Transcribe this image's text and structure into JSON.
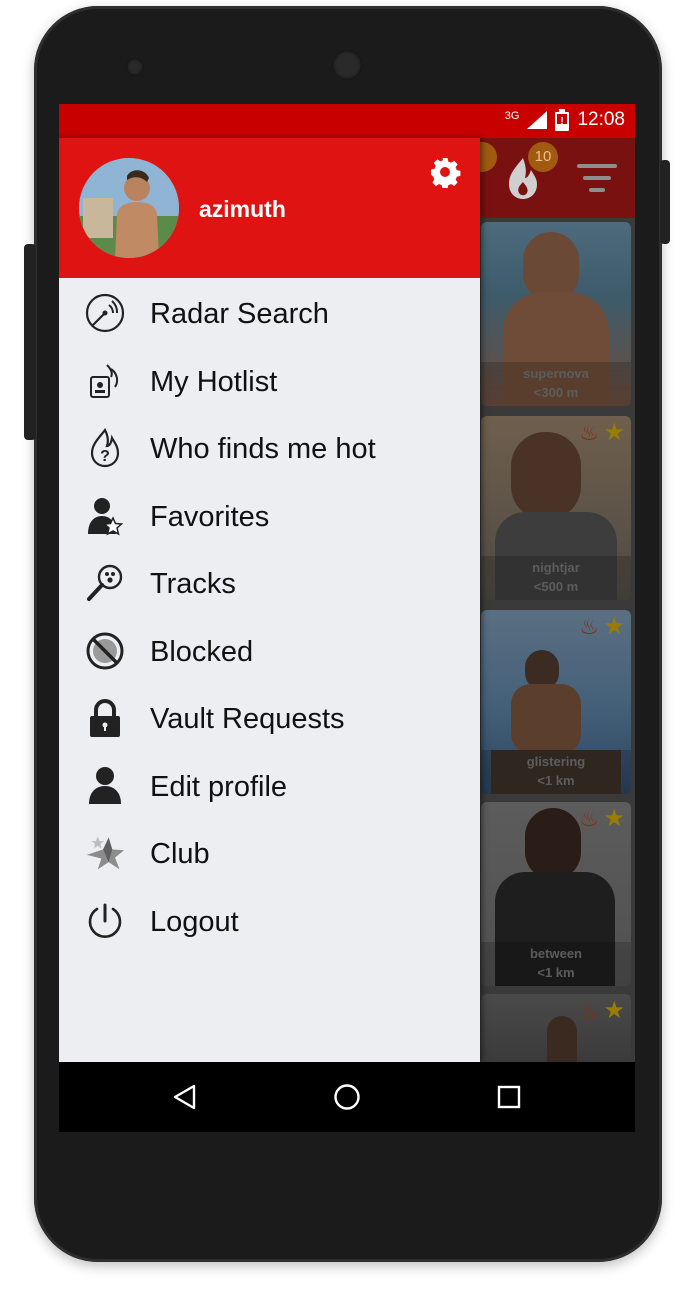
{
  "status": {
    "network": "3G",
    "time": "12:08"
  },
  "drawer": {
    "username": "azimuth",
    "menu": [
      {
        "label": "Radar Search",
        "icon": "radar-icon"
      },
      {
        "label": "My Hotlist",
        "icon": "hotlist-icon"
      },
      {
        "label": "Who finds me hot",
        "icon": "flame-question-icon"
      },
      {
        "label": "Favorites",
        "icon": "user-star-icon"
      },
      {
        "label": "Tracks",
        "icon": "magnifier-paw-icon"
      },
      {
        "label": "Blocked",
        "icon": "blocked-icon"
      },
      {
        "label": "Vault Requests",
        "icon": "lock-icon"
      },
      {
        "label": "Edit profile",
        "icon": "user-icon"
      },
      {
        "label": "Club",
        "icon": "club-star-icon"
      },
      {
        "label": "Logout",
        "icon": "power-icon"
      }
    ]
  },
  "background": {
    "badge_count": "10",
    "profiles": [
      {
        "name": "supernova",
        "distance": "<300 m"
      },
      {
        "name": "nightjar",
        "distance": "<500 m"
      },
      {
        "name": "glistering",
        "distance": "<1 km"
      },
      {
        "name": "between",
        "distance": "<1 km"
      }
    ]
  },
  "colors": {
    "brand_red": "#e01313",
    "status_red": "#c80000",
    "drawer_bg": "#eceef1"
  }
}
